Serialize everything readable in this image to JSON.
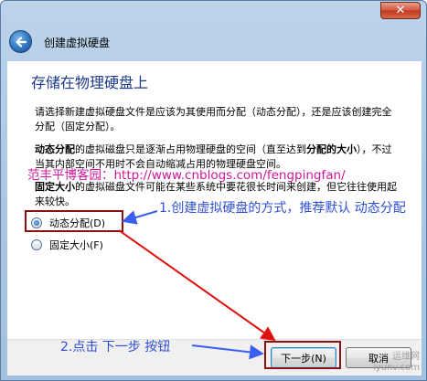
{
  "window": {
    "close_glyph": "✕"
  },
  "header": {
    "title": "创建虚拟硬盘"
  },
  "content": {
    "section_title": "存储在物理硬盘上",
    "intro": "请选择新建虚拟硬盘文件是应该为其使用而分配（动态分配），还是应该创建完全分配（固定分配）。",
    "dynamic_term": "动态分配",
    "dynamic_desc_a": "的虚拟磁盘只是逐渐占用物理硬盘的空间（直至达到",
    "dynamic_term2": "分配的大小",
    "dynamic_desc_b": "），不过当其内部空间不用时不会自动缩减占用的物理硬盘空间。",
    "fixed_term": "固定大小",
    "fixed_desc": "的虚拟磁盘文件可能在某些系统中要花很长时间来创建，但它往往使用起来较快。"
  },
  "options": [
    {
      "label": "动态分配(D)",
      "selected": true
    },
    {
      "label": "固定大小(F)",
      "selected": false
    }
  ],
  "buttons": {
    "next": "下一步(N)",
    "cancel": "取消"
  },
  "annotations": {
    "watermark": "范丰平博客园：http://www.cnblogs.com/fengpingfan/",
    "step1": "1.创建虚拟硬盘的方式，推荐默认 动态分配",
    "step2": "2.点击 下一步 按钮",
    "site_line1": "运维网",
    "site_line2": "iyunv.com"
  },
  "colors": {
    "accent": "#1e3a8a",
    "highlight": "#8b1010",
    "annotation": "#2f4fd6",
    "watermark": "#d0169c"
  }
}
